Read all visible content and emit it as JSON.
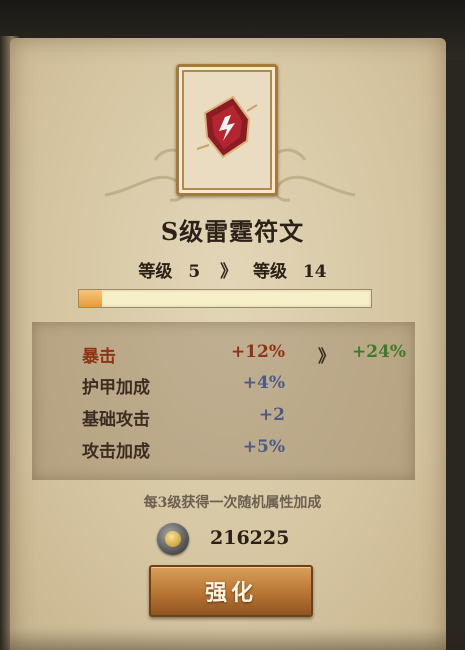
{
  "item": {
    "name": "S级雷霆符文",
    "icon": "thunder-rune-icon"
  },
  "level": {
    "label_current": "等级",
    "current": "5",
    "arrow": "》",
    "label_next": "等级",
    "next": "14",
    "progress": 0.08
  },
  "stats": [
    {
      "label": "暴击",
      "value": "+12%",
      "arrow": "》",
      "next_value": "+24%"
    },
    {
      "label": "护甲加成",
      "value": "+4%"
    },
    {
      "label": "基础攻击",
      "value": "+2"
    },
    {
      "label": "攻击加成",
      "value": "+5%"
    }
  ],
  "hint": "每3级获得一次随机属性加成",
  "currency": {
    "icon": "coin-icon",
    "amount": "216225"
  },
  "button": {
    "label": "强化"
  },
  "colors": {
    "crit": "#8e3414",
    "stat_value": "#4b5a86",
    "upgrade_value": "#3e7a2c",
    "button": "#b87432",
    "progress_fill": "#e89a3c"
  }
}
